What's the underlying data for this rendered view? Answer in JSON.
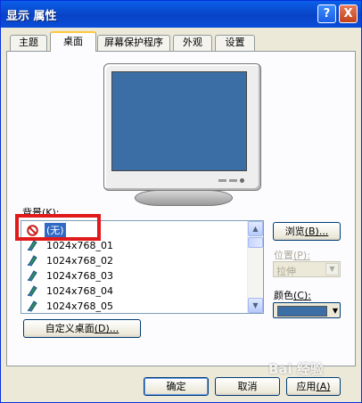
{
  "window": {
    "title": "显示 属性",
    "help_glyph": "?",
    "close_glyph": "X"
  },
  "tabs": [
    {
      "label": "主题"
    },
    {
      "label": "桌面"
    },
    {
      "label": "屏幕保护程序"
    },
    {
      "label": "外观"
    },
    {
      "label": "设置"
    }
  ],
  "active_tab": "桌面",
  "background": {
    "label": "背景",
    "hotkey": "(K):",
    "items": [
      {
        "label": "(无)",
        "icon": "no-symbol-icon",
        "selected": true
      },
      {
        "label": "1024x768_01",
        "icon": "picture-file-icon"
      },
      {
        "label": "1024x768_02",
        "icon": "picture-file-icon"
      },
      {
        "label": "1024x768_03",
        "icon": "picture-file-icon"
      },
      {
        "label": "1024x768_04",
        "icon": "picture-file-icon"
      },
      {
        "label": "1024x768_05",
        "icon": "picture-file-icon"
      }
    ]
  },
  "browse": {
    "label": "浏览",
    "hotkey": "(B)..."
  },
  "position": {
    "label": "位置",
    "hotkey": "(P):",
    "value": "拉伸"
  },
  "color": {
    "label": "颜色",
    "hotkey": "(C):",
    "value": "#3a6ea5"
  },
  "customize": {
    "label": "自定义桌面",
    "hotkey": "(D)..."
  },
  "footer": {
    "ok": "确定",
    "cancel": "取消",
    "apply": "应用",
    "apply_hotkey": "(A)"
  },
  "watermark": "Bai 经验",
  "colors": {
    "titlebar": "#0a4ed8",
    "desktop_preview": "#3a6ea5",
    "highlight_box": "#e01a1a",
    "selection": "#316ac5"
  }
}
